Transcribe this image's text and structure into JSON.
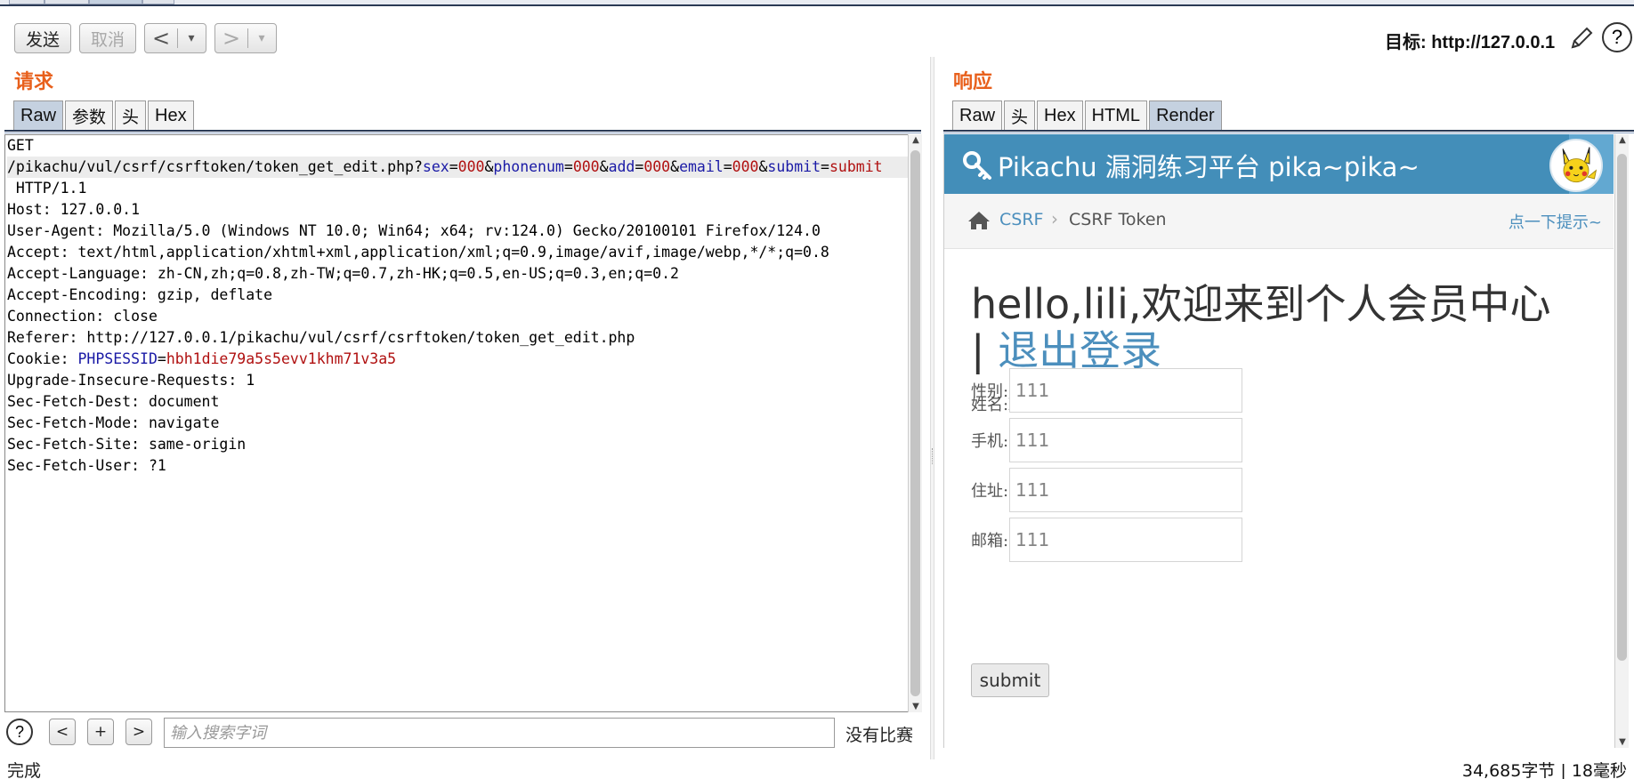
{
  "toolbar": {
    "send_label": "发送",
    "cancel_label": "取消",
    "back_arrow": "<",
    "forward_arrow": ">",
    "dropdown_glyph": "▾",
    "target_label": "目标: http://127.0.0.1",
    "help_glyph": "?"
  },
  "request": {
    "title": "请求",
    "tabs": [
      "Raw",
      "参数",
      "头",
      "Hex"
    ],
    "active_tab": "Raw",
    "lines": [
      "GET",
      "/pikachu/vul/csrf/csrftoken/token_get_edit.php?sex=000&phonenum=000&add=000&email=000&submit=submit",
      " HTTP/1.1",
      "Host: 127.0.0.1",
      "User-Agent: Mozilla/5.0 (Windows NT 10.0; Win64; x64; rv:124.0) Gecko/20100101 Firefox/124.0",
      "Accept: text/html,application/xhtml+xml,application/xml;q=0.9,image/avif,image/webp,*/*;q=0.8",
      "Accept-Language: zh-CN,zh;q=0.8,zh-TW;q=0.7,zh-HK;q=0.5,en-US;q=0.3,en;q=0.2",
      "Accept-Encoding: gzip, deflate",
      "Connection: close",
      "Referer: http://127.0.0.1/pikachu/vul/csrf/csrftoken/token_get_edit.php",
      "Cookie: PHPSESSID=hbh1die79a5s5evv1khm71v3a5",
      "Upgrade-Insecure-Requests: 1",
      "Sec-Fetch-Dest: document",
      "Sec-Fetch-Mode: navigate",
      "Sec-Fetch-Site: same-origin",
      "Sec-Fetch-User: ?1"
    ]
  },
  "search": {
    "help_glyph": "?",
    "prev_label": "<",
    "add_label": "+",
    "next_label": ">",
    "placeholder": "输入搜索字词",
    "result_text": "没有比赛"
  },
  "response": {
    "title": "响应",
    "tabs": [
      "Raw",
      "头",
      "Hex",
      "HTML",
      "Render"
    ],
    "active_tab": "Render",
    "page": {
      "header_title": "Pikachu 漏洞练习平台 pika~pika~",
      "breadcrumb_link": "CSRF",
      "breadcrumb_sep": "›",
      "breadcrumb_current": "CSRF Token",
      "hint_link": "点一下提示~",
      "greeting": "hello,lili,欢迎来到个人会员中心",
      "greeting_sep": "| ",
      "logout_link": "退出登录",
      "name_line": "姓名:lili",
      "fields": [
        {
          "label": "性别:",
          "value": "111"
        },
        {
          "label": "手机:",
          "value": "111"
        },
        {
          "label": "住址:",
          "value": "111"
        },
        {
          "label": "邮箱:",
          "value": "111"
        }
      ],
      "submit_label": "submit"
    }
  },
  "status": {
    "left": "完成",
    "right": "34,685字节 | 18毫秒"
  },
  "colors": {
    "section_title": "#e8601c",
    "param_key": "#1a1aa6",
    "param_value": "#b01010",
    "pk_header": "#438eb9",
    "pk_link": "#4c8fbd"
  }
}
